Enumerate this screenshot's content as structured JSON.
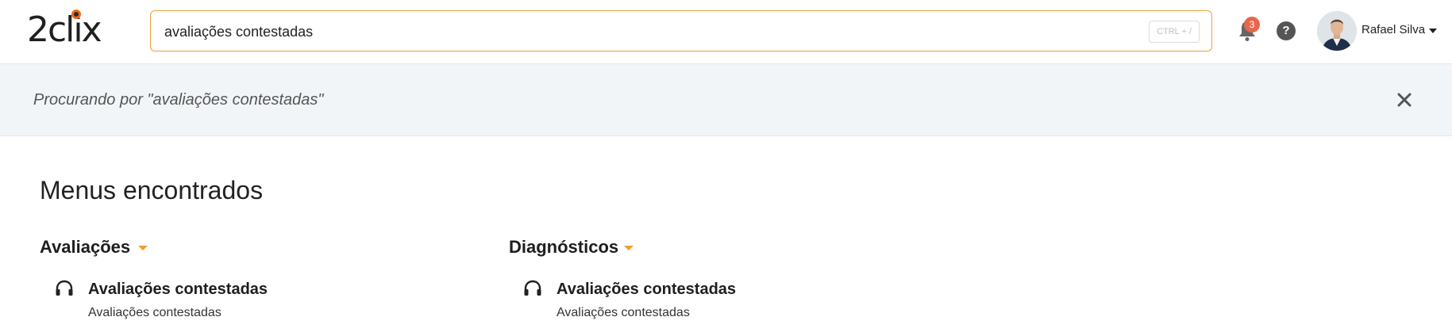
{
  "header": {
    "logo_text": "2clix",
    "search_value": "avaliações contestadas",
    "search_shortcut": "CTRL + /",
    "notification_count": "3",
    "help_symbol": "?",
    "user_name": "Rafael Silva"
  },
  "banner": {
    "text": "Procurando por \"avaliações contestadas\""
  },
  "main": {
    "title": "Menus encontrados",
    "groups": [
      {
        "label": "Avaliações",
        "items": [
          {
            "title": "Avaliações contestadas",
            "subtitle": "Avaliações contestadas",
            "icon": "headphones-icon"
          }
        ]
      },
      {
        "label": "Diagnósticos",
        "items": [
          {
            "title": "Avaliações contestadas",
            "subtitle": "Avaliações contestadas",
            "icon": "headphones-icon"
          }
        ]
      }
    ]
  },
  "colors": {
    "accent": "#eba23a",
    "caret": "#f39c28",
    "badge": "#e8664a",
    "banner_bg": "#f2f5f8"
  }
}
